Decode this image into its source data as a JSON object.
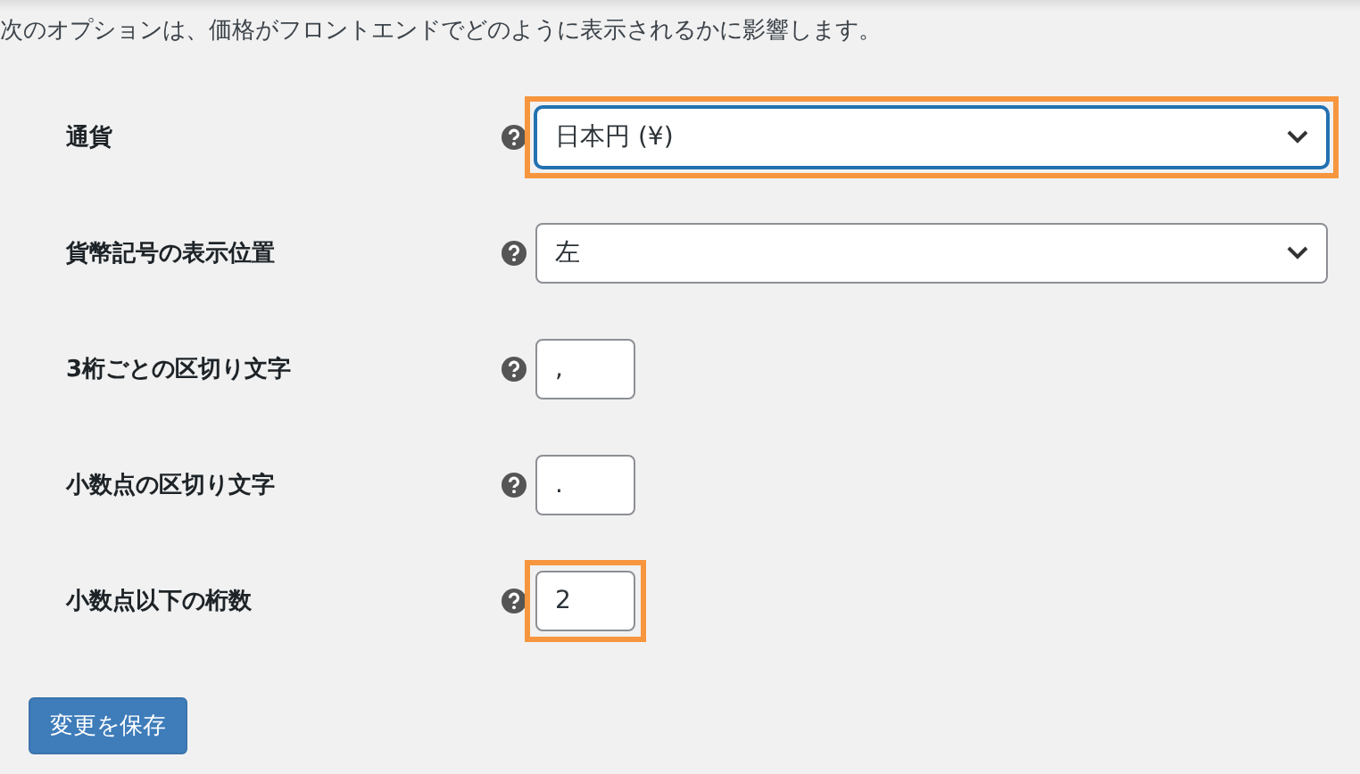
{
  "intro": "次のオプションは、価格がフロントエンドでどのように表示されるかに影響します。",
  "fields": [
    {
      "label": "通貨",
      "kind": "select",
      "value": "日本円 (¥)",
      "focused": true,
      "highlighted": true
    },
    {
      "label": "貨幣記号の表示位置",
      "kind": "select",
      "value": "左",
      "focused": false,
      "highlighted": false
    },
    {
      "label": "3桁ごとの区切り文字",
      "kind": "text",
      "value": ",",
      "focused": false,
      "highlighted": false
    },
    {
      "label": "小数点の区切り文字",
      "kind": "text",
      "value": ".",
      "focused": false,
      "highlighted": false
    },
    {
      "label": "小数点以下の桁数",
      "kind": "text",
      "value": "2",
      "focused": false,
      "highlighted": true
    }
  ],
  "save_button": "変更を保存"
}
